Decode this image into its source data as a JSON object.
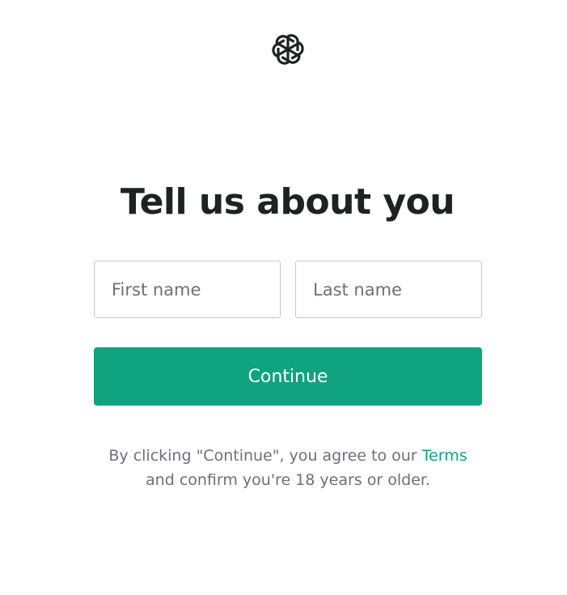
{
  "icons": {
    "logo": "openai-logo-icon"
  },
  "colors": {
    "accent": "#10a37f",
    "heading": "#202123",
    "muted_text": "#6e6e80",
    "input_border": "#c2c8d0"
  },
  "form": {
    "title": "Tell us about you",
    "first_name_placeholder": "First name",
    "first_name_value": "",
    "last_name_placeholder": "Last name",
    "last_name_value": "",
    "continue_label": "Continue"
  },
  "legal": {
    "text_before": "By clicking \"Continue\", you agree to our ",
    "terms_link": "Terms",
    "text_after": "and confirm you're 18 years or older."
  }
}
